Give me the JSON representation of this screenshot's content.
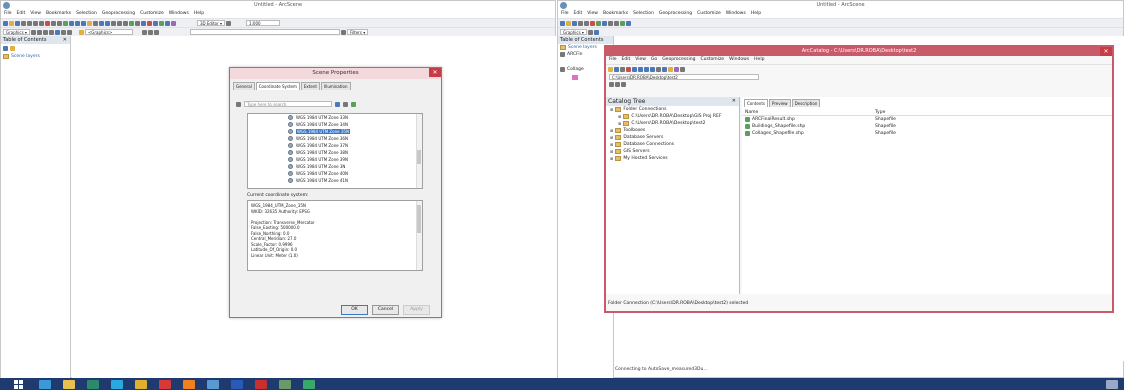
{
  "left": {
    "title": "Untitled - ArcScene",
    "menu": [
      "File",
      "Edit",
      "View",
      "Bookmarks",
      "Selection",
      "Geoprocessing",
      "Customize",
      "Windows",
      "Help"
    ],
    "toolbar": {
      "editor_label": "3D Editor ▾",
      "scale": "1:000",
      "graphics_label": "Graphics ▾",
      "graphics_dd": "<Graphics>",
      "filters_label": "Filters ▾"
    },
    "toc_title": "Table of Contents",
    "scene_layers": "Scene layers"
  },
  "dialog": {
    "title": "Scene Properties",
    "tabs": [
      "General",
      "Coordinate System",
      "Extent",
      "Illumination"
    ],
    "search_placeholder": "Type here to search",
    "items": [
      "WGS 1984 UTM Zone 33N",
      "WGS 1984 UTM Zone 34N",
      "WGS 1984 UTM Zone 35N",
      "WGS 1984 UTM Zone 36N",
      "WGS 1984 UTM Zone 37N",
      "WGS 1984 UTM Zone 38N",
      "WGS 1984 UTM Zone 39N",
      "WGS 1984 UTM Zone 3N",
      "WGS 1984 UTM Zone 40N",
      "WGS 1984 UTM Zone 41N"
    ],
    "selected_index": 2,
    "current_label": "Current coordinate system:",
    "details": [
      "WGS_1984_UTM_Zone_35N",
      "WKID: 32635 Authority: EPSG",
      "",
      "Projection: Transverse_Mercator",
      "False_Easting: 500000.0",
      "False_Northing: 0.0",
      "Central_Meridian: 27.0",
      "Scale_Factor: 0.9996",
      "Latitude_Of_Origin: 0.0",
      "Linear Unit: Meter (1.0)"
    ],
    "ok": "OK",
    "cancel": "Cancel",
    "apply": "Apply"
  },
  "right": {
    "title": "Untitled - ArcScene",
    "menu": [
      "File",
      "Edit",
      "View",
      "Bookmarks",
      "Selection",
      "Geoprocessing",
      "Customize",
      "Windows",
      "Help"
    ],
    "toc_title": "Table of Contents",
    "scene_layers": "Scene layers",
    "layer_prefix": "ARCFin",
    "collage_prefix": "Collage",
    "status": "Connecting to AutoSave_measured3Du..."
  },
  "catalog": {
    "title": "ArcCatalog - C:\\Users\\DR.ROBA\\Desktop\\test2",
    "menu": [
      "File",
      "Edit",
      "View",
      "Go",
      "Geoprocessing",
      "Customize",
      "Windows",
      "Help"
    ],
    "location": "C:\\Users\\DR.ROBA\\Desktop\\test2",
    "tree_title": "Catalog Tree",
    "tree": [
      "Folder Connections",
      "C:\\Users\\DR.ROBA\\Desktop\\GIS Proj REF",
      "C:\\Users\\DR.ROBA\\Desktop\\test2",
      "Toolboxes",
      "Database Servers",
      "Database Connections",
      "GIS Servers",
      "My Hosted Services"
    ],
    "tabs": [
      "Contents",
      "Preview",
      "Description"
    ],
    "col_name": "Name",
    "col_type": "Type",
    "rows": [
      {
        "name": "ARCFinalResult.shp",
        "type": "Shapefile"
      },
      {
        "name": "Buildings_Shapefile.shp",
        "type": "Shapefile"
      },
      {
        "name": "Collages_Shapefile.shp",
        "type": "Shapefile"
      }
    ],
    "status": "Folder Connection (C:\\Users\\DR.ROBA\\Desktop\\test2) selected"
  },
  "colors": {
    "accent": "#c85a6a",
    "taskbar": "#1f3a6e",
    "selection": "#3a78c8"
  }
}
